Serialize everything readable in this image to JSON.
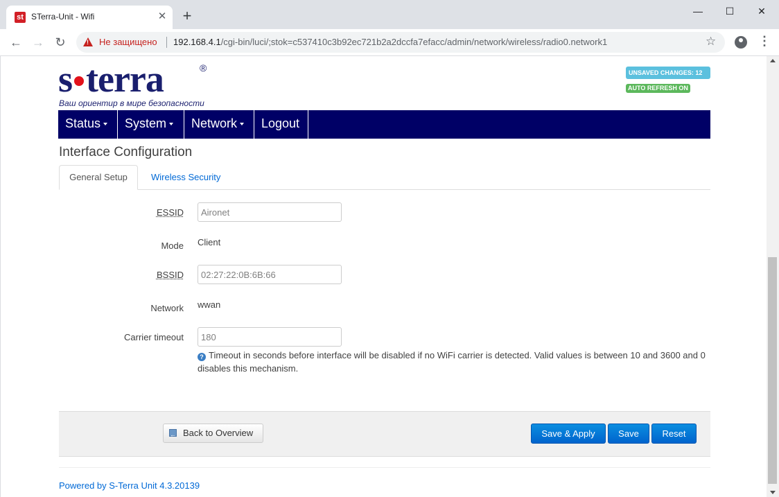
{
  "browser": {
    "tab_title": "STerra-Unit - Wifi",
    "favicon_text": "st",
    "close_glyph": "✕",
    "newtab_glyph": "+",
    "insecure_label": "Не защищено",
    "url_host": "192.168.4.1",
    "url_path": "/cgi-bin/luci/;stok=c537410c3b92ec721b2a2dccfa7efacc/admin/network/wireless/radio0.network1",
    "minimize_glyph": "—",
    "maximize_glyph": "☐",
    "close_window_glyph": "✕",
    "back_glyph": "←",
    "forward_glyph": "→",
    "reload_glyph": "↻",
    "star_glyph": "☆",
    "menu_glyph": "⋮"
  },
  "header": {
    "logo_left": "s",
    "logo_right": "terra",
    "logo_reg": "®",
    "slogan": "Ваш ориентир в мире безопасности",
    "unsaved_changes": "UNSAVED CHANGES: 12",
    "auto_refresh": "AUTO REFRESH ON"
  },
  "nav": {
    "items": [
      {
        "label": "Status"
      },
      {
        "label": "System"
      },
      {
        "label": "Network"
      },
      {
        "label": "Logout"
      }
    ]
  },
  "page": {
    "title": "Interface Configuration",
    "tabs": [
      {
        "label": "General Setup"
      },
      {
        "label": "Wireless Security"
      }
    ]
  },
  "form": {
    "essid_label": "ESSID",
    "essid_value": "Aironet",
    "mode_label": "Mode",
    "mode_value": "Client",
    "bssid_label": "BSSID",
    "bssid_value": "02:27:22:0B:6B:66",
    "network_label": "Network",
    "network_value": "wwan",
    "carrier_label": "Carrier timeout",
    "carrier_value": "180",
    "carrier_help": "Timeout in seconds before interface will be disabled if no WiFi carrier is detected. Valid values is between 10 and 3600 and 0 disables this mechanism."
  },
  "actions": {
    "back": "Back to Overview",
    "save_apply": "Save & Apply",
    "save": "Save",
    "reset": "Reset"
  },
  "footer": {
    "powered": "Powered by S-Terra Unit 4.3.20139"
  },
  "colors": {
    "nav_bg": "#000066",
    "link": "#0069d6",
    "badge_unsaved": "#5bc0de",
    "badge_auto": "#5cb85c",
    "primary_button": "#0064cd"
  }
}
